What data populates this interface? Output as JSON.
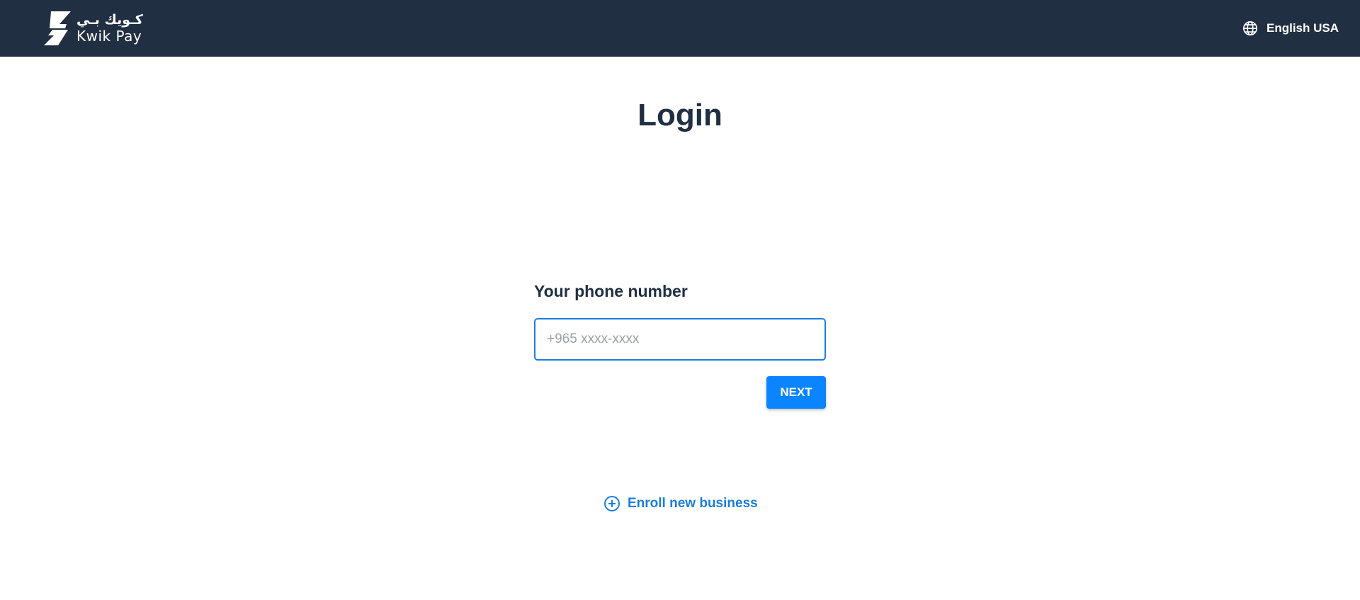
{
  "header": {
    "logo": {
      "arabic_text": "كـويك بـي",
      "english_text": "Kwik Pay"
    },
    "language": {
      "icon": "globe-icon",
      "label": "English USA"
    }
  },
  "main": {
    "title": "Login",
    "phone_label": "Your phone number",
    "phone_input": {
      "value": "",
      "placeholder": "+965 xxxx-xxxx"
    },
    "next_label": "NEXT",
    "enroll": {
      "icon": "plus-circle-icon",
      "label": "Enroll new business"
    }
  },
  "colors": {
    "header_bg": "#212f42",
    "accent": "#0a84ff",
    "link": "#1a7ee0",
    "text_dark": "#212f42"
  }
}
